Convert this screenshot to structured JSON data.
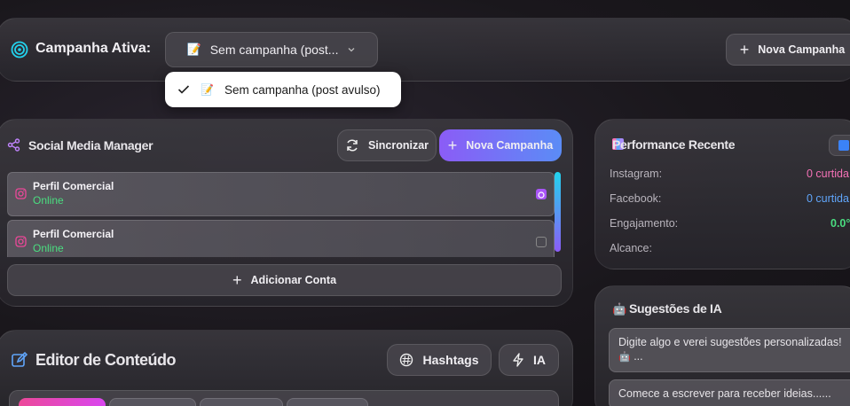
{
  "header": {
    "campaign_label": "Campanha Ativa:",
    "selected_campaign": "Sem campanha (post...",
    "new_campaign_label": "Nova Campanha"
  },
  "dropdown": {
    "options": [
      {
        "label": "Sem campanha (post avulso)",
        "selected": true
      }
    ]
  },
  "social_manager": {
    "title": "Social Media Manager",
    "sync_label": "Sincronizar",
    "new_campaign_label": "Nova Campanha",
    "accounts": [
      {
        "name": "Perfil Comercial",
        "status": "Online",
        "checked": true
      },
      {
        "name": "Perfil Comercial",
        "status": "Online",
        "checked": false
      }
    ],
    "add_account_label": "Adicionar Conta"
  },
  "editor": {
    "title": "Editor de Conteúdo",
    "hashtags_label": "Hashtags",
    "ia_label": "IA"
  },
  "performance": {
    "title": "Performance Recente",
    "rows": [
      {
        "label": "Instagram:",
        "value": "0 curtida",
        "color": "#f472b6"
      },
      {
        "label": "Facebook:",
        "value": "0 curtida",
        "color": "#60a5fa"
      },
      {
        "label": "Engajamento:",
        "value": "0.0°",
        "color": "#4ade80"
      },
      {
        "label": "Alcance:",
        "value": "",
        "color": "#e8e6ea"
      }
    ]
  },
  "ai_suggestions": {
    "title": "Sugestões de IA",
    "cards": [
      {
        "text": "Digite algo e verei sugestões personalizadas!",
        "text2": "..."
      },
      {
        "text": "Comece a escrever para receber ideias......"
      }
    ]
  },
  "colors": {
    "accent_purple": "#8b5cf6",
    "accent_blue": "#5b8cf6",
    "online_green": "#4ade80",
    "instagram_pink": "#ec4899"
  }
}
